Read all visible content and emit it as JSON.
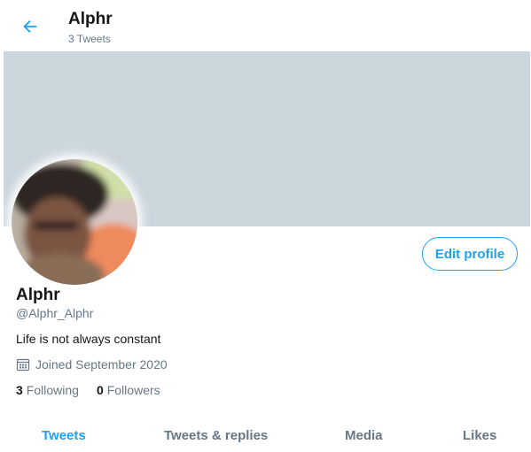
{
  "header": {
    "title": "Alphr",
    "subtitle": "3 Tweets",
    "back_icon": "arrow-left-icon"
  },
  "colors": {
    "accent": "#1da1f2",
    "banner": "#ccd6dd",
    "secondary_text": "#657786"
  },
  "profile": {
    "edit_button_label": "Edit profile",
    "name": "Alphr",
    "handle": "@Alphr_Alphr",
    "bio": "Life is not always constant",
    "joined": "Joined September 2020",
    "joined_icon": "calendar-icon",
    "following_count": "3",
    "following_label": "Following",
    "followers_count": "0",
    "followers_label": "Followers"
  },
  "tabs": [
    {
      "label": "Tweets",
      "active": true
    },
    {
      "label": "Tweets & replies",
      "active": false
    },
    {
      "label": "Media",
      "active": false
    },
    {
      "label": "Likes",
      "active": false
    }
  ]
}
